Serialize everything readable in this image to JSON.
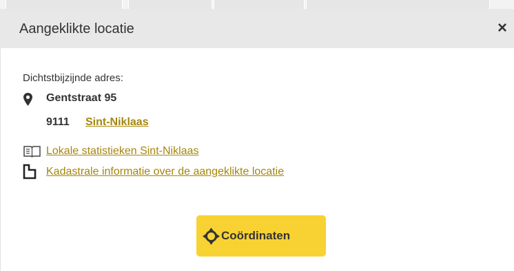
{
  "colors": {
    "header_bg": "#e8e8e8",
    "link": "#a5860b",
    "button_bg": "#f7d232",
    "text": "#333333"
  },
  "panel": {
    "title": "Aangeklikte locatie",
    "close_label": "×"
  },
  "address": {
    "label": "Dichtstbijzijnde adres:",
    "street": "Gentstraat 95",
    "postcode": "9111",
    "city": "Sint-Niklaas",
    "icon": "map-pin-icon"
  },
  "links": [
    {
      "label": "Lokale statistieken Sint-Niklaas",
      "icon": "book-icon"
    },
    {
      "label": "Kadastrale informatie over de aangeklikte locatie",
      "icon": "cadastre-icon"
    }
  ],
  "button": {
    "label": "Coördinaten",
    "icon": "crosshair-icon"
  }
}
